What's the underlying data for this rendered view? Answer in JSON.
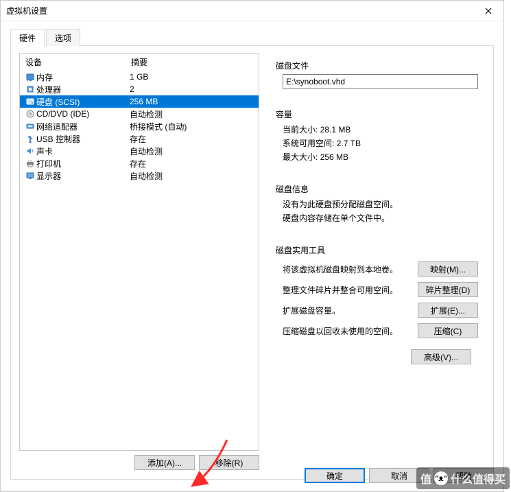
{
  "window": {
    "title": "虚拟机设置"
  },
  "tabs": {
    "hardware": "硬件",
    "options": "选项"
  },
  "device_header": {
    "device": "设备",
    "summary": "摘要"
  },
  "devices": [
    {
      "icon": "memory-icon",
      "name": "内存",
      "summary": "1 GB"
    },
    {
      "icon": "cpu-icon",
      "name": "处理器",
      "summary": "2"
    },
    {
      "icon": "disk-icon",
      "name": "硬盘 (SCSI)",
      "summary": "256 MB",
      "selected": true
    },
    {
      "icon": "cd-icon",
      "name": "CD/DVD (IDE)",
      "summary": "自动检测"
    },
    {
      "icon": "network-icon",
      "name": "网络适配器",
      "summary": "桥接模式 (自动)"
    },
    {
      "icon": "usb-icon",
      "name": "USB 控制器",
      "summary": "存在"
    },
    {
      "icon": "sound-icon",
      "name": "声卡",
      "summary": "自动检测"
    },
    {
      "icon": "printer-icon",
      "name": "打印机",
      "summary": "存在"
    },
    {
      "icon": "display-icon",
      "name": "显示器",
      "summary": "自动检测"
    }
  ],
  "buttons": {
    "add": "添加(A)...",
    "remove": "移除(R)",
    "ok": "确定",
    "cancel": "取消",
    "help": "帮助"
  },
  "disk_file": {
    "legend": "磁盘文件",
    "path": "E:\\synoboot.vhd"
  },
  "capacity": {
    "legend": "容量",
    "current_label": "当前大小:",
    "current_value": "28.1 MB",
    "free_label": "系统可用空间:",
    "free_value": "2.7 TB",
    "max_label": "最大大小:",
    "max_value": "256 MB"
  },
  "disk_info": {
    "legend": "磁盘信息",
    "line1": "没有为此硬盘预分配磁盘空间。",
    "line2": "硬盘内容存储在单个文件中。"
  },
  "utilities": {
    "legend": "磁盘实用工具",
    "map_desc": "将该虚拟机磁盘映射到本地卷。",
    "map_btn": "映射(M)...",
    "defrag_desc": "整理文件碎片并整合可用空间。",
    "defrag_btn": "碎片整理(D)",
    "expand_desc": "扩展磁盘容量。",
    "expand_btn": "扩展(E)...",
    "compact_desc": "压缩磁盘以回收未使用的空间。",
    "compact_btn": "压缩(C)",
    "advanced_btn": "高级(V)..."
  },
  "watermark": "值_什么值得买"
}
